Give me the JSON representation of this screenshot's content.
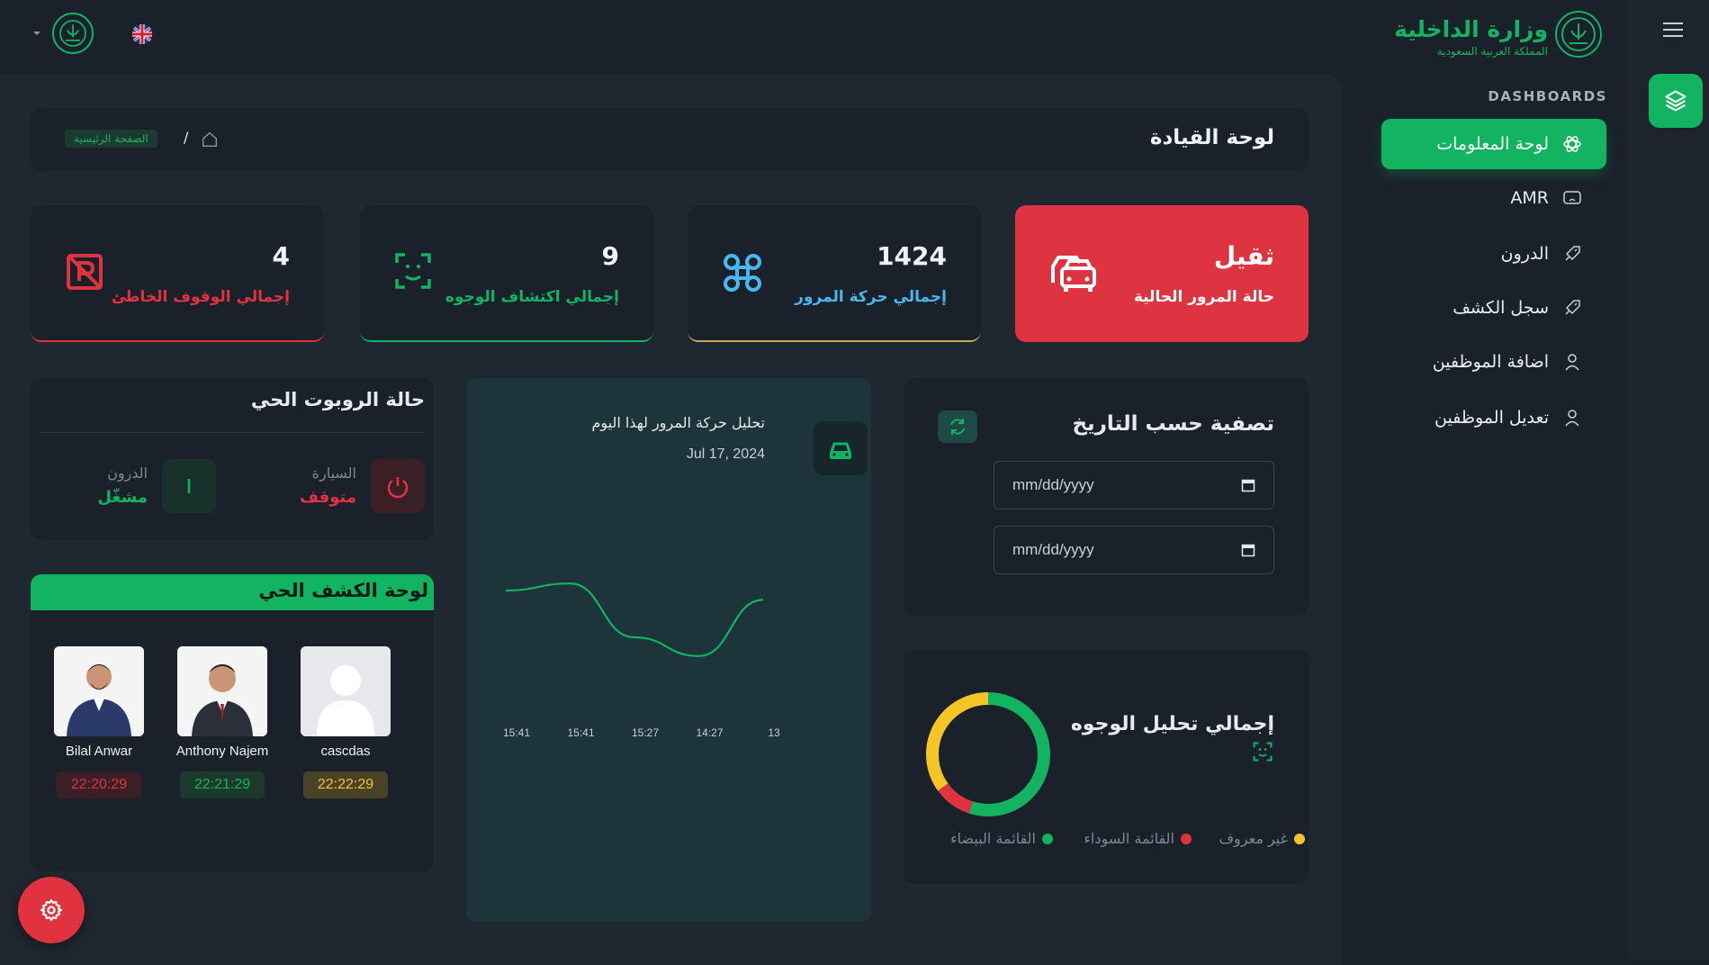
{
  "sidebar": {
    "logo_title": "وزارة الداخلية",
    "logo_subtitle": "المملكة العربية السعودية",
    "section_label": "DASHBOARDS",
    "items": [
      {
        "label": "لوحة المعلومات",
        "icon": "atom-icon",
        "active": true
      },
      {
        "label": "AMR",
        "icon": "monitor-icon"
      },
      {
        "label": "الدرون",
        "icon": "rocket-icon"
      },
      {
        "label": "سجل الكشف",
        "icon": "rocket-icon"
      },
      {
        "label": "اضافة الموظفين",
        "icon": "user-icon"
      },
      {
        "label": "تعديل الموظفين",
        "icon": "user-icon"
      }
    ]
  },
  "header": {
    "page_title": "لوحة القيادة",
    "breadcrumb_home": "الصفحة الرئيسية",
    "breadcrumb_separator": "/"
  },
  "stats": [
    {
      "value": "ثقيل",
      "label": "حالة المرور الحالية",
      "icon": "car-icon",
      "color": "#de3341"
    },
    {
      "value": "1424",
      "label": "إجمالي حركة المرور",
      "icon": "drone-icon",
      "color": "#47b9ee"
    },
    {
      "value": "9",
      "label": "إجمالي اكتشاف الوجوه",
      "icon": "face-scan-icon",
      "color": "#12b461"
    },
    {
      "value": "4",
      "label": "إجمالي الوقوف الخاطئ",
      "icon": "no-parking-icon",
      "color": "#e0323f"
    }
  ],
  "robot_status": {
    "title": "حالة الروبوت الحي",
    "car_label": "السيارة",
    "car_status": "متوقف",
    "drone_label": "الدرون",
    "drone_status": "مشغّل"
  },
  "live_detection": {
    "title": "لوحة الكشف الحي",
    "people": [
      {
        "name": "cascdas",
        "time": "22:22:29",
        "color": "#f5c425"
      },
      {
        "name": "Anthony Najem",
        "time": "22:21:29",
        "color": "#12b461"
      },
      {
        "name": "Bilal Anwar",
        "time": "22:20:29",
        "color": "#e0323f"
      }
    ]
  },
  "traffic_chart": {
    "title": "تحليل حركة المرور لهذا اليوم",
    "date": "Jul 17, 2024"
  },
  "chart_data": [
    {
      "type": "line",
      "title": "تحليل حركة المرور لهذا اليوم",
      "x": [
        "15:41",
        "15:41",
        "15:27",
        "14:27",
        "13"
      ],
      "series": [
        {
          "values": [
            40,
            43,
            20,
            12,
            36
          ]
        }
      ],
      "color": "#12b461",
      "grid": false
    },
    {
      "type": "pie",
      "title": "إجمالي تحليل الوجوه",
      "categories": [
        "القائمة البيضاء",
        "القائمة السوداء",
        "غير معروف"
      ],
      "values": [
        55,
        10,
        35
      ],
      "colors": [
        "#12b461",
        "#e0323f",
        "#f5c425"
      ]
    }
  ],
  "date_filter": {
    "title": "تصفية حسب التاريخ",
    "from_placeholder": "mm/dd/yyyy",
    "to_placeholder": "mm/dd/yyyy"
  },
  "faces_analysis": {
    "title": "إجمالي تحليل الوجوه",
    "legend": [
      {
        "label": "غير معروف",
        "color": "#f5c425"
      },
      {
        "label": "القائمة السوداء",
        "color": "#e0323f"
      },
      {
        "label": "القائمة البيضاء",
        "color": "#12b461"
      }
    ]
  }
}
